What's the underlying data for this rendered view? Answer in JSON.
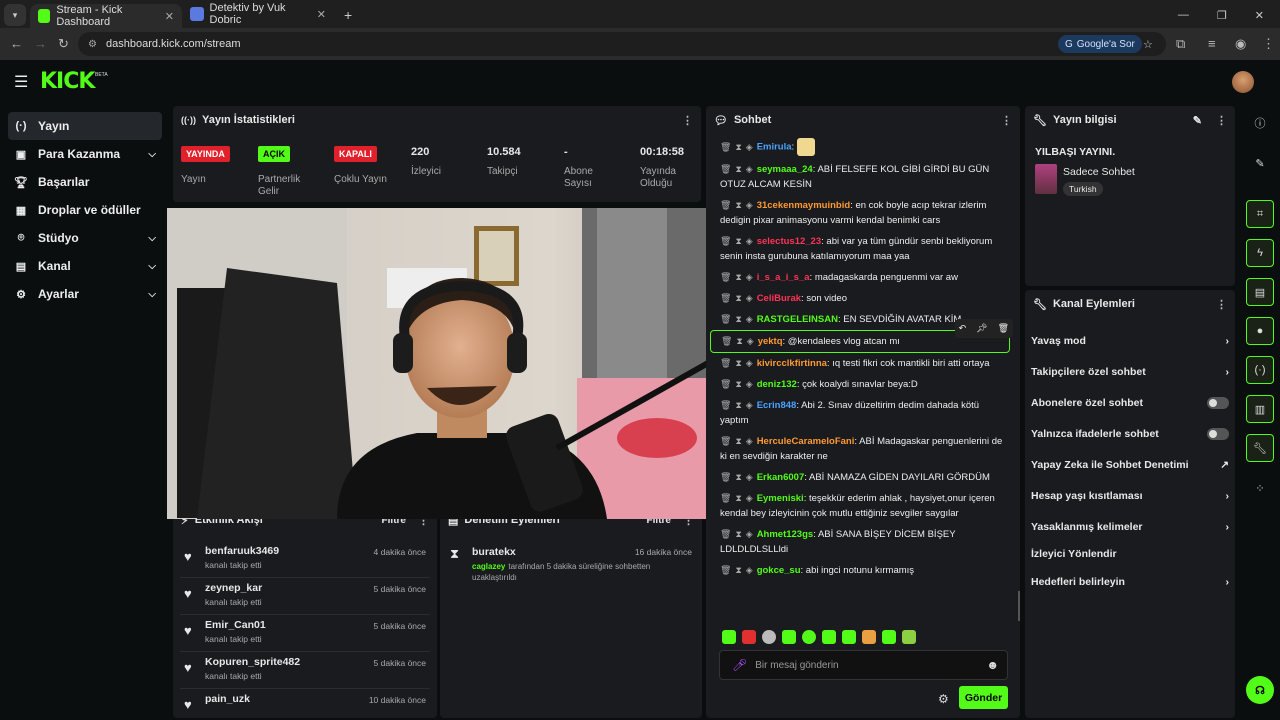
{
  "browser": {
    "tabs": [
      {
        "title": "Stream - Kick Dashboard"
      },
      {
        "title": "Detektiv by Vuk Dobric"
      }
    ],
    "url": "dashboard.kick.com/stream",
    "google_btn": "Google'a Sor"
  },
  "brand": {
    "logo": "KICK",
    "beta": "BETA",
    "accent": "#53fc18"
  },
  "sidebar": {
    "items": [
      {
        "label": "Yayın",
        "icon": "broadcast-icon"
      },
      {
        "label": "Para Kazanma",
        "icon": "money-icon"
      },
      {
        "label": "Başarılar",
        "icon": "trophy-icon"
      },
      {
        "label": "Droplar ve ödüller",
        "icon": "gift-icon"
      },
      {
        "label": "Stüdyo",
        "icon": "studio-icon"
      },
      {
        "label": "Kanal",
        "icon": "channel-icon"
      },
      {
        "label": "Ayarlar",
        "icon": "gear-icon"
      }
    ]
  },
  "stats": {
    "title": "Yayın İstatistikleri",
    "items": [
      {
        "value": "YAYINDA",
        "label": "Yayın"
      },
      {
        "value": "AÇIK",
        "label": "Partnerlik Gelir"
      },
      {
        "value": "KAPALI",
        "label": "Çoklu Yayın"
      },
      {
        "value": "220",
        "label": "İzleyici"
      },
      {
        "value": "10.584",
        "label": "Takipçi"
      },
      {
        "value": "-",
        "label": "Abone Sayısı"
      },
      {
        "value": "00:18:58",
        "label": "Yayında Olduğu"
      }
    ]
  },
  "activity": {
    "title": "Etkinlik Akışı",
    "filter": "Filtre",
    "items": [
      {
        "user": "benfaruuk3469",
        "action": "kanalı takip etti",
        "time": "4 dakika önce"
      },
      {
        "user": "zeynep_kar",
        "action": "kanalı takip etti",
        "time": "5 dakika önce"
      },
      {
        "user": "Emir_Can01",
        "action": "kanalı takip etti",
        "time": "5 dakika önce"
      },
      {
        "user": "Kopuren_sprite482",
        "action": "kanalı takip etti",
        "time": "5 dakika önce"
      },
      {
        "user": "pain_uzk",
        "action": "",
        "time": "10 dakika önce"
      }
    ]
  },
  "moderation": {
    "title": "Denetim Eylemleri",
    "filter": "Filtre",
    "items": [
      {
        "user": "buratekx",
        "time": "16 dakika önce",
        "mod": "caglazey",
        "desc": "tarafından 5 dakika süreliğine sohbetten uzaklaştırıldı"
      }
    ]
  },
  "chat": {
    "title": "Sohbet",
    "messages": [
      {
        "user": "Emirula",
        "color": "#4aa3ff",
        "text": ""
      },
      {
        "user": "seymaaa_24",
        "color": "#53fc18",
        "text": "ABİ FELSEFE KOL GİBİ GİRDİ BU GÜN OTUZ ALCAM KESİN"
      },
      {
        "user": "31cekenmaymuinbid",
        "color": "#ff9933",
        "text": "en cok boyle acıp tekrar izlerim dedigin pixar animasyonu varmi kendal benimki cars"
      },
      {
        "user": "selectus12_23",
        "color": "#ff3355",
        "text": "abi var ya tüm gündür senbi bekliyorum senin insta gurubuna katılamıyorum maa yaa"
      },
      {
        "user": "i_s_a_i_s_a",
        "color": "#ff3355",
        "text": "madagaskarda penguenmi var aw"
      },
      {
        "user": "CeliBurak",
        "color": "#ff3355",
        "text": "son video"
      },
      {
        "user": "RASTGELEINSAN",
        "color": "#53fc18",
        "text": "EN SEVDİĞİN AVATAR KİM"
      },
      {
        "user": "yektq",
        "color": "#ff9933",
        "text": "@kendalees vlog atcan mı"
      },
      {
        "user": "kivircclkfirtinna",
        "color": "#ff9933",
        "text": "ıq testi fikri cok mantikli biri atti ortaya"
      },
      {
        "user": "deniz132",
        "color": "#53fc18",
        "text": "çok koalydi sınavlar beya:D"
      },
      {
        "user": "Ecrin848",
        "color": "#4aa3ff",
        "text": "Abi 2. Sınav düzeltirim dedim dahada kötü yaptım"
      },
      {
        "user": "HerculeCarameloFani",
        "color": "#ff9933",
        "text": "ABİ Madagaskar penguenlerini de ki en sevdiğin karakter ne"
      },
      {
        "user": "Erkan6007",
        "color": "#53fc18",
        "text": "ABİ NAMAZA GİDEN DAYILARI GÖRDÜM"
      },
      {
        "user": "Eymeniski",
        "color": "#53fc18",
        "text": "teşekkür ederim ahlak , haysiyet,onur içeren kendal bey izleyicinin çok mutlu ettiğiniz sevgiler saygılar"
      },
      {
        "user": "Ahmet123gs",
        "color": "#53fc18",
        "text": "ABİ SANA BİŞEY DİCEM BİŞEY LDLDLDLSLLldi"
      },
      {
        "user": "gokce_su",
        "color": "#53fc18",
        "text": "abi ingci notunu kırmamış"
      }
    ],
    "placeholder": "Bir mesaj gönderin",
    "send": "Gönder"
  },
  "streaminfo": {
    "title": "Yayın bilgisi",
    "stream_title": "YILBAŞI YAYINI.",
    "category": "Sadece Sohbet",
    "language": "Turkish"
  },
  "channel_actions": {
    "title": "Kanal Eylemleri",
    "items": [
      {
        "label": "Yavaş mod",
        "control": "chevron"
      },
      {
        "label": "Takipçilere özel sohbet",
        "control": "chevron"
      },
      {
        "label": "Abonelere özel sohbet",
        "control": "toggle"
      },
      {
        "label": "Yalnızca ifadelerle sohbet",
        "control": "toggle"
      },
      {
        "label": "Yapay Zeka ile Sohbet Denetimi",
        "control": "external"
      },
      {
        "label": "Hesap yaşı kısıtlaması",
        "control": "chevron"
      },
      {
        "label": "Yasaklanmış kelimeler",
        "control": "chevron"
      },
      {
        "label": "İzleyici Yönlendir",
        "control": "none"
      },
      {
        "label": "Hedefleri belirleyin",
        "control": "chevron"
      }
    ]
  }
}
